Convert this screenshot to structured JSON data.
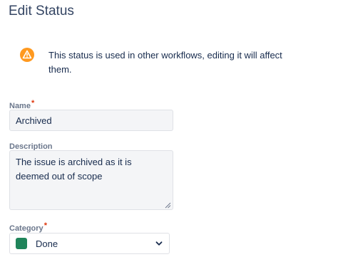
{
  "dialog": {
    "title": "Edit Status"
  },
  "warning": {
    "icon": "warning-icon",
    "message": "This status is used in other workflows, editing it will affect them."
  },
  "name_field": {
    "label": "Name",
    "required_marker": "*",
    "value": "Archived"
  },
  "description_field": {
    "label": "Description",
    "value": "The issue is archived as it is deemed out of scope"
  },
  "category_field": {
    "label": "Category",
    "required_marker": "*",
    "selected": "Done",
    "swatch_color": "#1f845a",
    "icon": "chevron-down-icon"
  },
  "colors": {
    "warning": "#ff991f",
    "required": "#de350b"
  }
}
